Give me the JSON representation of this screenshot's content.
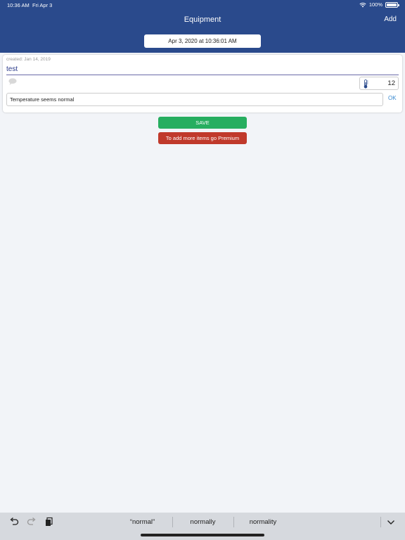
{
  "status_bar": {
    "time": "10:36 AM",
    "date": "Fri Apr 3",
    "battery": "100%"
  },
  "nav": {
    "title": "Equipment",
    "add_label": "Add"
  },
  "date_button": {
    "label": "Apr 3, 2020 at 10:36:01 AM"
  },
  "item": {
    "created": "created: Jan 14, 2019",
    "name": "test",
    "temperature": "12",
    "note": "Temperature seems normal",
    "ok_label": "OK"
  },
  "actions": {
    "save_label": "SAVE",
    "premium_label": "To add more items go Premium"
  },
  "keyboard": {
    "suggestions": [
      "“normal”",
      "normally",
      "normality"
    ]
  },
  "colors": {
    "header": "#2a4a8c",
    "save": "#27ae60",
    "premium": "#c0392b",
    "accent": "#3a8ad0"
  }
}
